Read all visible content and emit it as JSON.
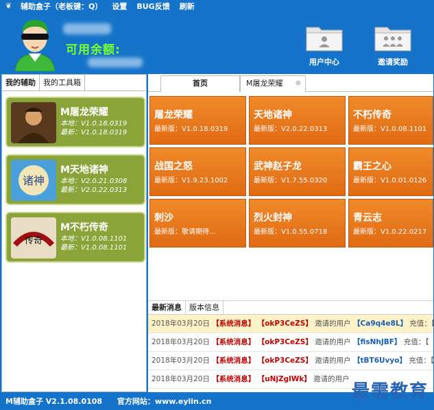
{
  "menu": {
    "title": "辅助盒子（老板键：Q）",
    "settings": "设置",
    "bug": "BUG反馈",
    "refresh": "刷新"
  },
  "header": {
    "balance_label": "可用余额:",
    "user_center": "用户中心",
    "invite_reward": "邀请奖励"
  },
  "left_tabs": [
    "我的辅助",
    "我的工具箱"
  ],
  "games": [
    {
      "name": "M屠龙荣耀",
      "local": "本地：V1.0.18.0319",
      "latest": "最新：V1.0.18.0319"
    },
    {
      "name": "M天地诸神",
      "local": "本地：V2.0.21.0308",
      "latest": "最新：V2.0.22.0313"
    },
    {
      "name": "M不朽传奇",
      "local": "本地：V1.0.08.1101",
      "latest": "最新：V1.0.08.1101"
    }
  ],
  "right_tabs": {
    "home": "首页",
    "game": "M屠龙荣耀"
  },
  "tiles": [
    {
      "name": "屠龙荣耀",
      "ver": "最新版：V1.0.18.0319"
    },
    {
      "name": "天地诸神",
      "ver": "最新版：V2.0.22.0313"
    },
    {
      "name": "不朽传奇",
      "ver": "最新版：V1.0.08.1101"
    },
    {
      "name": "战国之怒",
      "ver": "最新版：V1.9.23.1002"
    },
    {
      "name": "武神赵子龙",
      "ver": "最新版：V1.7.55.0320"
    },
    {
      "name": "霸王之心",
      "ver": "最新版：V1.0.01.0126"
    },
    {
      "name": "刺沙",
      "ver": "最新版：敬请期待..."
    },
    {
      "name": "烈火封神",
      "ver": "最新版：V1.0.55.0718"
    },
    {
      "name": "青云志",
      "ver": "最新版：V1.0.22.0217"
    }
  ],
  "news_tabs": [
    "最新消息",
    "版本信息"
  ],
  "news": [
    {
      "date": "2018年03月20日",
      "tag": "【系统消息】",
      "user": "【okP3CeZS】",
      "mid": "邀请的用户",
      "target": "【Ca9q4e8L】",
      "tail": "充值：【"
    },
    {
      "date": "2018年03月20日",
      "tag": "【系统消息】",
      "user": "【okP3CeZS】",
      "mid": "邀请的用户",
      "target": "【fisNhJBF】",
      "tail": "充值：【"
    },
    {
      "date": "2018年03月20日",
      "tag": "【系统消息】",
      "user": "【okP3CeZS】",
      "mid": "邀请的用户",
      "target": "【tBT6Uvyo】",
      "tail": "充值：【"
    },
    {
      "date": "2018年03月20日",
      "tag": "【系统消息】",
      "user": "【uNjZglWk】",
      "mid": "邀请的用户",
      "target": "",
      "tail": ""
    }
  ],
  "status": {
    "version": "M辅助盒子 V2.1.08.0108",
    "site": "官方网站：www.eylin.cn"
  },
  "watermark": "最需教育"
}
